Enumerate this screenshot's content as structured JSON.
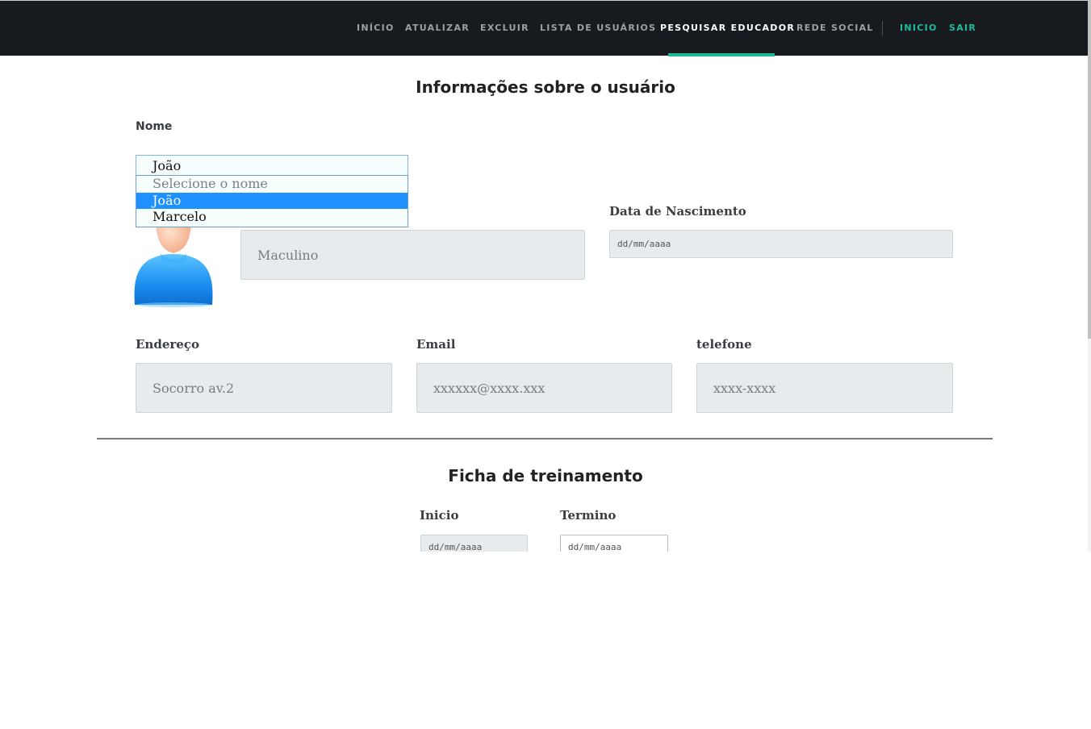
{
  "nav": {
    "items": [
      "INÍCIO",
      "ATUALIZAR",
      "EXCLUIR",
      "LISTA DE USUÁRIOS",
      "PESQUISAR EDUCADOR",
      "REDE SOCIAL"
    ],
    "active": "PESQUISAR EDUCADOR",
    "right": [
      "INICIO",
      "SAIR"
    ],
    "accent_color": "#1abc9c"
  },
  "user_info": {
    "title": "Informações sobre o usuário",
    "nome_label": "Nome",
    "nome_select_value": "João",
    "nome_options": [
      "Selecione o nome",
      "João",
      "Marcelo"
    ],
    "sexo_value": "Maculino",
    "birth_label": "Data de Nascimento",
    "birth_placeholder": "dd/mm/aaaa",
    "address_label": "Endereço",
    "address_value": "Socorro av.2",
    "email_label": "Email",
    "email_placeholder": "xxxxxx@xxxx.xxx",
    "phone_label": "telefone",
    "phone_placeholder": "xxxx-xxxx",
    "avatar_icon": "user-avatar-icon"
  },
  "training": {
    "title": "Ficha de treinamento",
    "start_label": "Inicio",
    "start_placeholder": "dd/mm/aaaa",
    "end_label": "Termino",
    "end_placeholder": "dd/mm/aaaa"
  }
}
